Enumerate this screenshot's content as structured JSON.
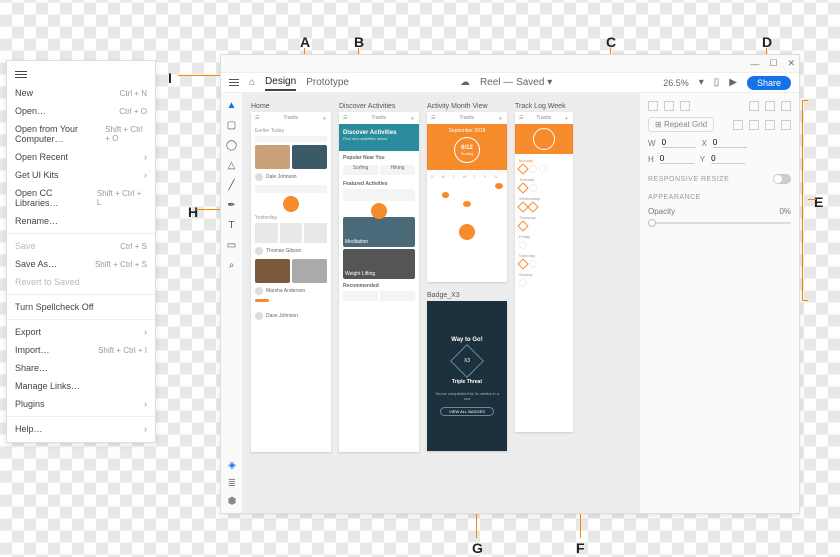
{
  "callouts": {
    "A": "A",
    "B": "B",
    "C": "C",
    "D": "D",
    "E": "E",
    "F": "F",
    "G": "G",
    "H": "H",
    "I": "I"
  },
  "window": {
    "tabs": {
      "design": "Design",
      "prototype": "Prototype"
    },
    "doc_status": "Reel  —  Saved  ▾",
    "zoom": "26.5%",
    "share": "Share"
  },
  "tools": [
    "select",
    "rect",
    "ellipse",
    "polygon",
    "line",
    "pen",
    "text",
    "artboard",
    "zoom"
  ],
  "artboards": [
    {
      "name": "Home",
      "brand": "Tractiv"
    },
    {
      "name": "Discover Activities",
      "brand": "Tractiv",
      "hero": "Discover Activities",
      "s1": "Popular Near You",
      "s2": "Featured Activities",
      "s3": "Recommended",
      "tag1": "Surfing",
      "tag2": "Hiking",
      "med": "Meditation",
      "wl": "Weight Lifting"
    },
    {
      "name": "Activity Month View",
      "brand": "Tractiv",
      "month": "September 2018",
      "day": "6/12",
      "act": "Surfing"
    },
    {
      "name": "Track Log Week",
      "brand": "Tractiv",
      "d0": "Monday",
      "d1": "Tuesday",
      "d2": "Wednesday",
      "d3": "Thursday",
      "d4": "Friday",
      "d5": "Saturday",
      "d6": "Sunday"
    }
  ],
  "badge": {
    "name": "Badge_X3",
    "title": "Way to Go!",
    "count": "X3",
    "sub": "Triple Threat",
    "desc": "You've completed this 3x weeks in a row"
  },
  "props": {
    "repeat": "Repeat Grid",
    "w": "W",
    "wval": "0",
    "x": "X",
    "xval": "0",
    "h": "H",
    "hval": "0",
    "y": "Y",
    "yval": "0",
    "responsive": "RESPONSIVE RESIZE",
    "appearance": "APPEARANCE",
    "opacity": "Opacity",
    "opval": "0%"
  },
  "menu": {
    "items": [
      {
        "label": "New",
        "sc": "Ctrl + N"
      },
      {
        "label": "Open…",
        "sc": "Ctrl + O"
      },
      {
        "label": "Open from Your Computer…",
        "sc": "Shift + Ctrl + O"
      },
      {
        "label": "Open Recent",
        "sub": true
      },
      {
        "label": "Get UI Kits",
        "sub": true
      },
      {
        "label": "Open CC Libraries…",
        "sc": "Shift + Ctrl + L"
      },
      {
        "label": "Rename…"
      },
      {
        "sep": true
      },
      {
        "label": "Save",
        "sc": "Ctrl + S",
        "dis": true
      },
      {
        "label": "Save As…",
        "sc": "Shift + Ctrl + S"
      },
      {
        "label": "Revert to Saved",
        "dis": true
      },
      {
        "sep": true
      },
      {
        "label": "Turn Spellcheck Off"
      },
      {
        "sep": true
      },
      {
        "label": "Export",
        "sub": true
      },
      {
        "label": "Import…",
        "sc": "Shift + Ctrl + I"
      },
      {
        "label": "Share…"
      },
      {
        "label": "Manage Links…"
      },
      {
        "label": "Plugins",
        "sub": true
      },
      {
        "sep": true
      },
      {
        "label": "Help…",
        "sub": true
      }
    ]
  },
  "feed": {
    "today": "Earlier Today",
    "yesterday": "Yesterday",
    "u1": "Thomas Gibson",
    "u2": "Dale Johnson",
    "u3": "Marsha Anderson",
    "u4": "Dave Johnson"
  }
}
